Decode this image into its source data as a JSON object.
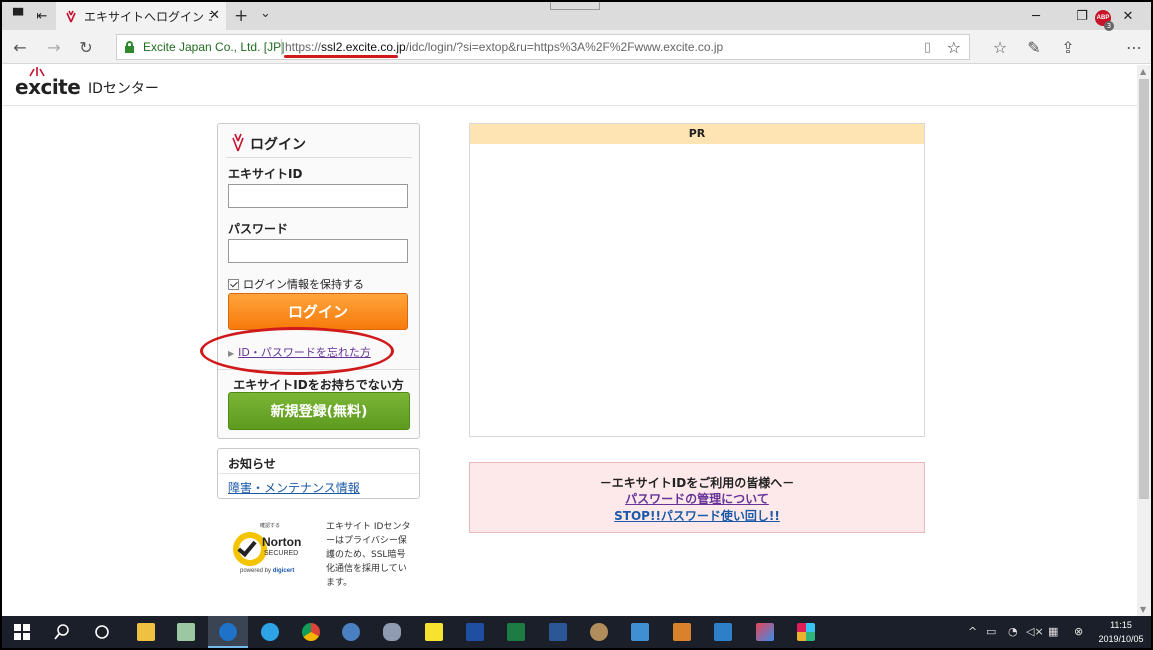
{
  "browser": {
    "tab_title": "エキサイトへログイン エキサ",
    "cert_label": "Excite Japan Co., Ltd. [JP]",
    "url_scheme": "https://",
    "url_domain": "ssl2.excite.co.jp",
    "url_path": "/idc/login/?si=extop&ru=https%3A%2F%2Fwww.excite.co.jp",
    "abp_badge": "3"
  },
  "site": {
    "logo": "excite",
    "header_title": "IDセンター"
  },
  "login": {
    "title": "ログイン",
    "id_label": "エキサイトID",
    "password_label": "パスワード",
    "keep_login_label": "ログイン情報を保持する",
    "keep_login_checked": true,
    "login_button": "ログイン",
    "forgot_link": "ID・パスワードを忘れた方",
    "no_id_heading": "エキサイトIDをお持ちでない方",
    "register_button": "新規登録(無料)"
  },
  "notice": {
    "title": "お知らせ",
    "link": "障害・メンテナンス情報"
  },
  "norton": {
    "top_text": "確認する",
    "name": "Norton",
    "secured": "SECURED",
    "powered": "powered by",
    "brand": "digicert",
    "ssl_text": "エキサイト IDセンターはプライバシー保護のため、SSL暗号化通信を採用しています。"
  },
  "pr": {
    "heading": "PR"
  },
  "info": {
    "title": "－エキサイトIDをご利用の皆様へ－",
    "link1": "パスワードの管理について",
    "link2": "STOP!!パスワード使い回し!!"
  },
  "taskbar": {
    "time": "11:15",
    "date": "2019/10/05"
  },
  "colors": {
    "annotation": "#d0191b",
    "login_button": "#f77a0b",
    "register_button": "#5e9a1f",
    "pr_header": "#ffe4b3",
    "info_bg": "#fde9ea"
  }
}
